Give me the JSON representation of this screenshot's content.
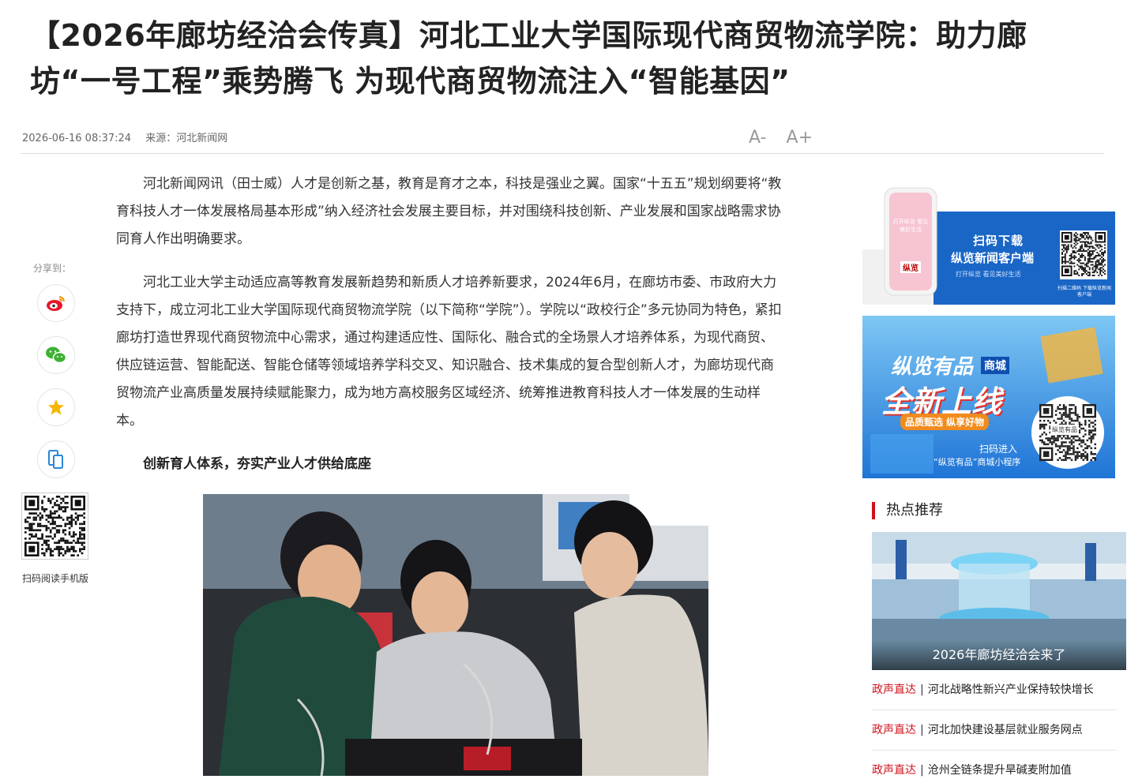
{
  "article": {
    "title": "【2026年廊坊经洽会传真】河北工业大学国际现代商贸物流学院：助力廊坊“一号工程”乘势腾飞 为现代商贸物流注入“智能基因”",
    "datetime": "2026-06-16 08:37:24",
    "source": "来源：河北新闻网",
    "font_decrease": "A-",
    "font_increase": "A+",
    "paragraphs": [
      "河北新闻网讯（田士威）人才是创新之基，教育是育才之本，科技是强业之翼。国家“十五五”规划纲要将“教育科技人才一体发展格局基本形成”纳入经济社会发展主要目标，并对围绕科技创新、产业发展和国家战略需求协同育人作出明确要求。",
      "河北工业大学主动适应高等教育发展新趋势和新质人才培养新要求，2024年6月，在廊坊市委、市政府大力支持下，成立河北工业大学国际现代商贸物流学院（以下简称“学院”）。学院以“政校行企”多元协同为特色，紧扣廊坊打造世界现代商贸物流中心需求，通过构建适应性、国际化、融合式的全场景人才培养体系，为现代商贸、供应链运营、智能配送、智能仓储等领域培养学科交叉、知识融合、技术集成的复合型创新人才，为廊坊现代商贸物流产业高质量发展持续赋能聚力，成为地方高校服务区域经济、统筹推进教育科技人才一体发展的生动样本。"
    ],
    "subhead": "创新育人体系，夯实产业人才供给底座"
  },
  "share": {
    "label": "分享到：",
    "buttons": [
      "weibo-icon",
      "wechat-icon",
      "favorite-star-icon",
      "mobile-icon"
    ],
    "qr_label": "扫码阅读手机版"
  },
  "ads": {
    "ad1": {
      "headline": "扫码下载",
      "app_name": "纵览新闻客户端",
      "slogan": "打开纵览 看见美好生活",
      "qr_note": "扫描二维码 下载纵览新闻客户端",
      "phone_text": "打开纵览 看见美好生活",
      "phone_logo": "纵览"
    },
    "ad2": {
      "brand": "纵览有品",
      "brand_tag": "商城",
      "headline": "全新上线",
      "tagline": "品质甄选 纵享好物",
      "cta": "扫码进入",
      "cta2": "“纵览有品”商城小程序",
      "qr_center": "纵览有品"
    }
  },
  "hot": {
    "title": "热点推荐",
    "feature_caption": "2026年廊坊经洽会来了",
    "items": [
      {
        "tag": "政声直达",
        "text": "河北战略性新兴产业保持较快增长"
      },
      {
        "tag": "政声直达",
        "text": "河北加快建设基层就业服务网点"
      },
      {
        "tag": "政声直达",
        "text": "沧州全链条提升旱碱麦附加值"
      }
    ]
  },
  "colors": {
    "accent_red": "#d0111b",
    "ad_blue": "#1f74d6",
    "text": "#333333"
  }
}
